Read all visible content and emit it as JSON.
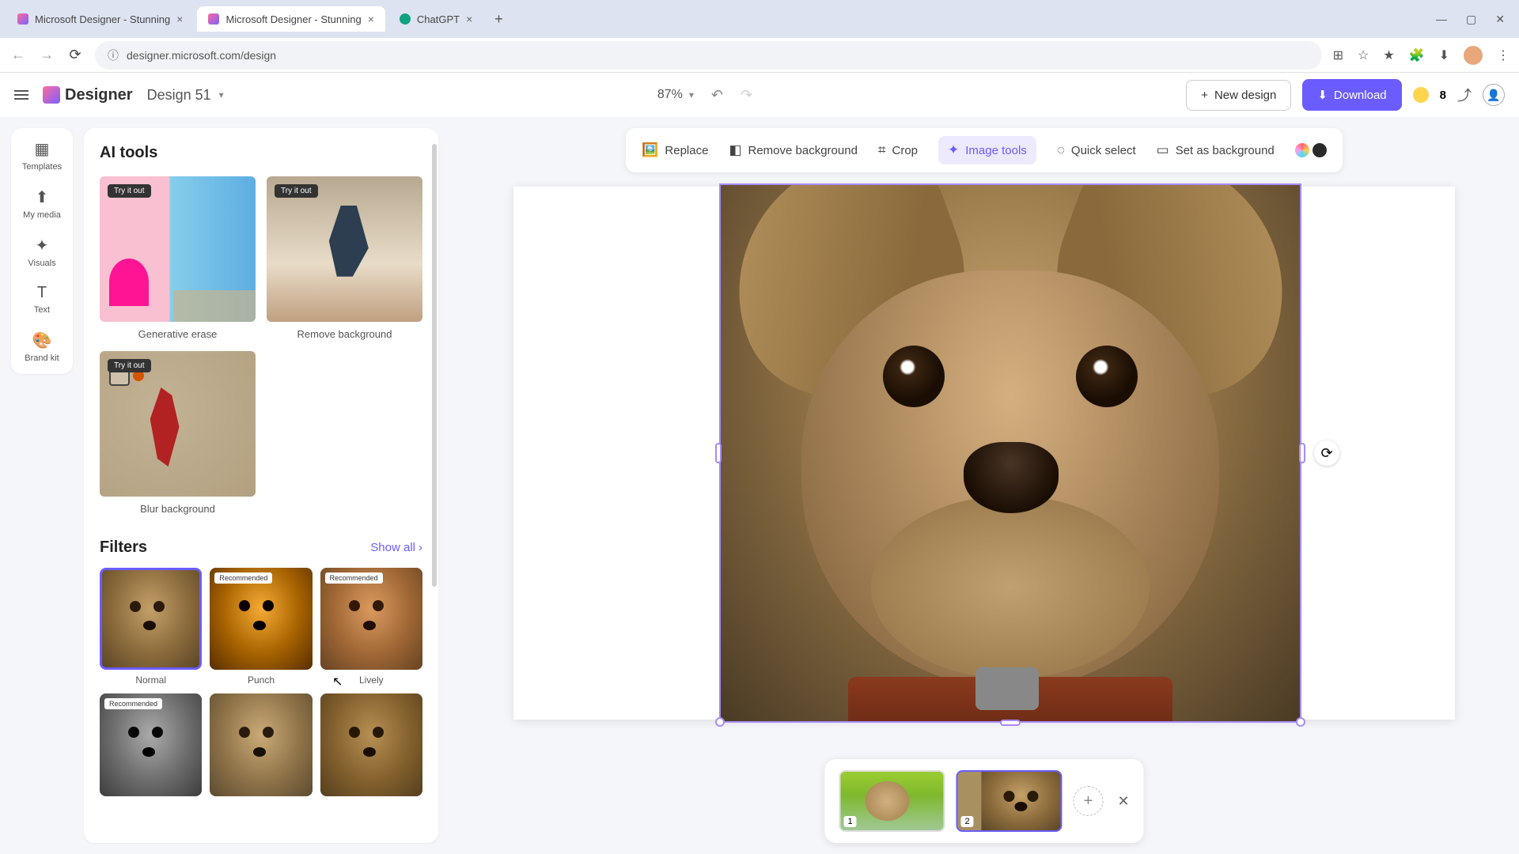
{
  "browser": {
    "tabs": [
      {
        "title": "Microsoft Designer - Stunning",
        "active": false
      },
      {
        "title": "Microsoft Designer - Stunning",
        "active": true
      },
      {
        "title": "ChatGPT",
        "active": false
      }
    ],
    "url": "designer.microsoft.com/design"
  },
  "header": {
    "brand": "Designer",
    "design_name": "Design 51",
    "zoom": "87%",
    "new_design": "New design",
    "download": "Download",
    "credits": "8"
  },
  "left_rail": {
    "items": [
      "Templates",
      "My media",
      "Visuals",
      "Text",
      "Brand kit"
    ]
  },
  "side_panel": {
    "ai_tools_title": "AI tools",
    "try_badge": "Try it out",
    "tools": [
      {
        "label": "Generative erase"
      },
      {
        "label": "Remove background"
      },
      {
        "label": "Blur background"
      }
    ],
    "filters_title": "Filters",
    "show_all": "Show all",
    "recommended_badge": "Recommended",
    "filters": [
      {
        "label": "Normal",
        "selected": true
      },
      {
        "label": "Punch",
        "recommended": true
      },
      {
        "label": "Lively",
        "recommended": true
      },
      {
        "label": "",
        "recommended": true
      },
      {
        "label": ""
      },
      {
        "label": ""
      }
    ]
  },
  "context_toolbar": {
    "replace": "Replace",
    "remove_bg": "Remove background",
    "crop": "Crop",
    "image_tools": "Image tools",
    "quick_select": "Quick select",
    "set_bg": "Set as background"
  },
  "pages": {
    "items": [
      {
        "num": "1",
        "active": false
      },
      {
        "num": "2",
        "active": true
      }
    ]
  }
}
